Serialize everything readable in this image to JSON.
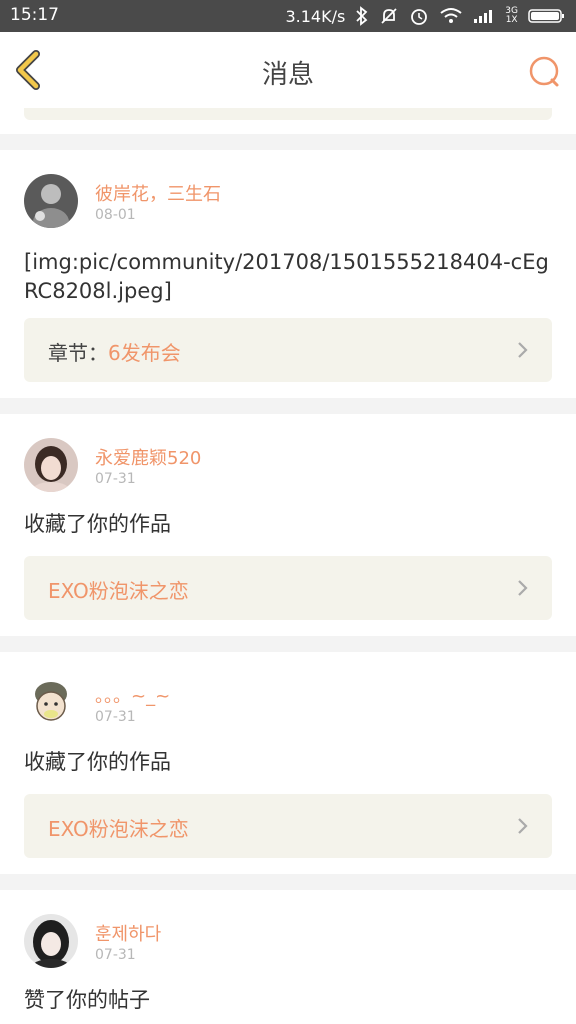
{
  "status_bar": {
    "time": "15:17",
    "speed": "3.14K/s",
    "network_top": "3G",
    "network_bottom": "1X",
    "icons": [
      "bluetooth-icon",
      "mute-icon",
      "alarm-icon",
      "wifi-icon",
      "signal-icon",
      "battery-icon"
    ]
  },
  "navbar": {
    "title": "消息",
    "back_icon": "chevron-left-icon",
    "search_icon": "search-icon"
  },
  "messages": [
    {
      "user": "彼岸花，三生石",
      "date": "08-01",
      "content": "[img:pic/community/201708/1501555218404-cEgRC8208l.jpeg]",
      "ref_label": "章节：",
      "ref_value": "6发布会"
    },
    {
      "user": "永爱鹿颖520",
      "date": "07-31",
      "content": "收藏了你的作品",
      "ref_label": "",
      "ref_value": "EXO粉泡沫之恋"
    },
    {
      "user": "。。。~_~",
      "date": "07-31",
      "content": "收藏了你的作品",
      "ref_label": "",
      "ref_value": "EXO粉泡沫之恋"
    },
    {
      "user": "훈제하다",
      "date": "07-31",
      "content": "赞了你的帖子"
    }
  ],
  "colors": {
    "accent": "#f0956a",
    "back_icon": "#f2c84b",
    "ref_background": "#f4f3eb"
  }
}
